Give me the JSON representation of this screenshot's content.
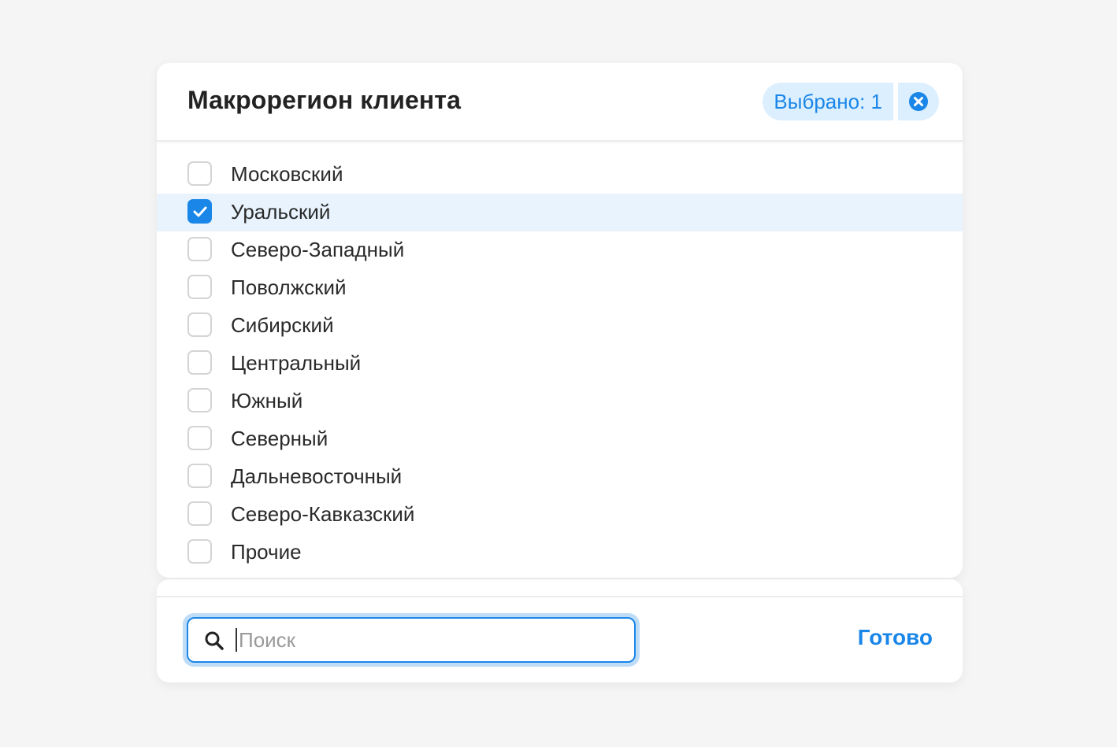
{
  "filter": {
    "title": "Макрорегион клиента",
    "selected_count_label": "Выбрано: 1",
    "clear_icon": "close-circle-icon"
  },
  "options": [
    {
      "label": "Московский",
      "checked": false
    },
    {
      "label": "Уральский",
      "checked": true
    },
    {
      "label": "Северо-Западный",
      "checked": false
    },
    {
      "label": "Поволжский",
      "checked": false
    },
    {
      "label": "Сибирский",
      "checked": false
    },
    {
      "label": "Центральный",
      "checked": false
    },
    {
      "label": "Южный",
      "checked": false
    },
    {
      "label": "Северный",
      "checked": false
    },
    {
      "label": "Дальневосточный",
      "checked": false
    },
    {
      "label": "Северо-Кавказский",
      "checked": false
    },
    {
      "label": "Прочие",
      "checked": false
    }
  ],
  "footer": {
    "search_placeholder": "Поиск",
    "search_value": "",
    "search_icon": "search-icon",
    "done_label": "Готово"
  },
  "colors": {
    "accent": "#1a86e8",
    "selected_row": "#e8f3fd",
    "badge_bg": "#dcefff"
  }
}
